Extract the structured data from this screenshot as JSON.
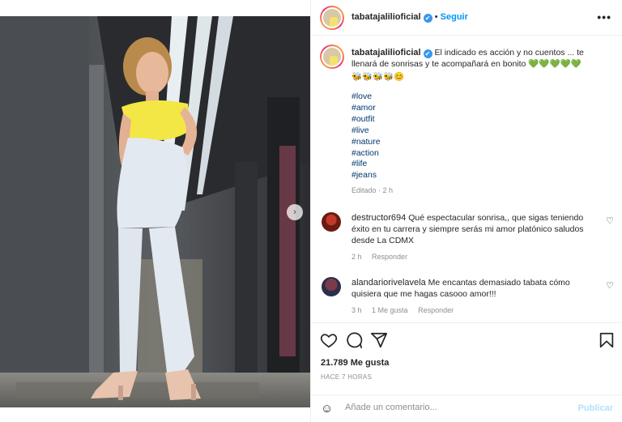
{
  "post": {
    "username": "tabatajalilioficial",
    "follow_label": "Seguir",
    "more_label": "•••"
  },
  "caption": {
    "username": "tabatajalilioficial",
    "text": "El indicado es acción y no cuentos ... te llenará de sonrisas y te acompañará en bonito 💚💚💚💚💚",
    "emoji_line": "🐝🐝🐝🐝😊",
    "hashtags": [
      "#love",
      "#amor",
      "#outfit",
      "#live",
      "#nature",
      "#action",
      "#life",
      "#jeans"
    ],
    "edited": "Editado · 2 h"
  },
  "comments": [
    {
      "username": "destructor694",
      "text": "Qué espectacular sonrisa,, que sigas teniendo éxito en tu carrera y siempre serás mi amor platónico saludos desde La CDMX",
      "time": "2 h",
      "likes": "",
      "reply": "Responder"
    },
    {
      "username": "alandariorivelavela",
      "text": "Me encantas demasiado tabata cómo quisiera que me hagas casooo amor!!!",
      "time": "3 h",
      "likes": "1 Me gusta",
      "reply": "Responder"
    }
  ],
  "stats": {
    "likes": "21.789 Me gusta",
    "posted": "HACE 7 HORAS"
  },
  "add_comment": {
    "placeholder": "Añade un comentario...",
    "publish_label": "Publicar"
  },
  "icons": {
    "verified": "✔",
    "heart": "♡",
    "nav_next": "›",
    "emoji": "☺"
  },
  "colors": {
    "accent": "#0095f6",
    "hashtag": "#00376b",
    "muted": "#8e8e8e",
    "top": "#f3e745",
    "jeans": "#e3e9f1"
  }
}
